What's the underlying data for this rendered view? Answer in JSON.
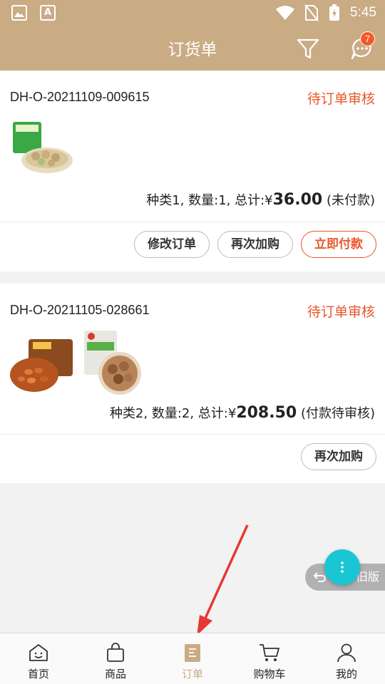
{
  "status_bar": {
    "time": "5:45",
    "icons": [
      "image-icon",
      "a-icon",
      "wifi-icon",
      "no-sim-icon",
      "battery-charging-icon"
    ]
  },
  "header": {
    "title": "订货单",
    "message_badge": "7"
  },
  "orders": [
    {
      "id": "DH-O-20211109-009615",
      "status": "待订单审核",
      "summary_prefix": "种类1, 数量:1, 总计:",
      "currency": "¥",
      "amount": "36.00",
      "summary_suffix": " (未付款)",
      "actions": [
        "修改订单",
        "再次加购",
        "立即付款"
      ]
    },
    {
      "id": "DH-O-20211105-028661",
      "status": "待订单审核",
      "summary_prefix": "种类2, 数量:2, 总计:",
      "currency": "¥",
      "amount": "208.50",
      "summary_suffix": " (付款待审核)",
      "actions": [
        "再次加购"
      ]
    }
  ],
  "old_version_label": "旧版",
  "tabs": [
    {
      "label": "首页",
      "icon": "home-face-icon",
      "active": false
    },
    {
      "label": "商品",
      "icon": "bag-icon",
      "active": false
    },
    {
      "label": "订单",
      "icon": "order-list-icon",
      "active": true
    },
    {
      "label": "购物车",
      "icon": "cart-icon",
      "active": false
    },
    {
      "label": "我的",
      "icon": "user-icon",
      "active": false
    }
  ],
  "colors": {
    "brand": "#c9ab84",
    "status_red": "#e8572a",
    "fab": "#19c6d4",
    "annotation_arrow": "#e53935"
  }
}
